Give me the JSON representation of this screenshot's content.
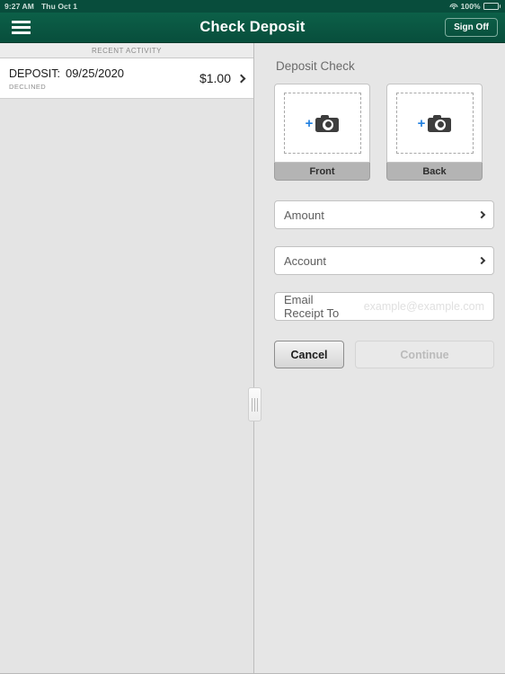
{
  "status_bar": {
    "time": "9:27 AM",
    "date": "Thu Oct 1",
    "battery_percent": "100%",
    "wifi_icon": "wifi-icon",
    "battery_icon": "battery-full-icon"
  },
  "nav": {
    "menu_icon": "hamburger-menu-icon",
    "title": "Check Deposit",
    "sign_off_label": "Sign Off"
  },
  "left_pane": {
    "section_header": "RECENT ACTIVITY",
    "activity": [
      {
        "label": "DEPOSIT:",
        "date": "09/25/2020",
        "status": "DECLINED",
        "amount": "$1.00",
        "chevron_icon": "chevron-right-icon"
      }
    ]
  },
  "right_pane": {
    "panel_title": "Deposit Check",
    "captures": [
      {
        "label": "Front",
        "plus_icon": "plus-icon",
        "camera_icon": "camera-icon"
      },
      {
        "label": "Back",
        "plus_icon": "plus-icon",
        "camera_icon": "camera-icon"
      }
    ],
    "fields": [
      {
        "label": "Amount",
        "chevron_icon": "chevron-right-icon"
      },
      {
        "label": "Account",
        "chevron_icon": "chevron-right-icon"
      }
    ],
    "email_field": {
      "label": "Email Receipt To",
      "placeholder": "example@example.com",
      "value": ""
    },
    "buttons": {
      "cancel_label": "Cancel",
      "continue_label": "Continue",
      "continue_disabled": true
    },
    "splitter_icon": "drag-handle-icon"
  },
  "colors": {
    "brand_green": "#0a5a46",
    "status_bar_green": "#084d3c",
    "accent_blue": "#1f7fe0",
    "page_gray": "#e4e4e4",
    "label_gray": "#6b6b6b"
  }
}
